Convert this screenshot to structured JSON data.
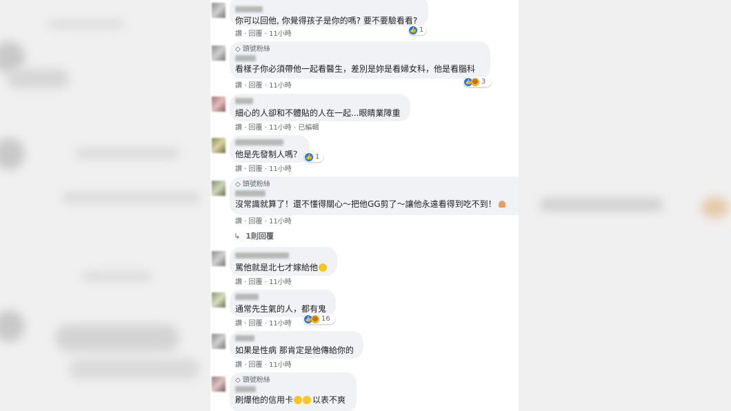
{
  "comments": [
    {
      "text": "你可以回他, 你覺得孩子是你的嗎? 要不要驗看看?",
      "meta": "讚 · 回覆 · 11小時",
      "reaction_count": "1",
      "top_fan": false
    },
    {
      "badge": "頭號粉絲",
      "text": "看樣子你必須帶他一起看醫生，差別是妳是看婦女科，他是看腦科",
      "meta": "讚 · 回覆 · 11小時",
      "reaction_count": "3",
      "top_fan": true
    },
    {
      "text": "細心的人卻和不體貼的人在一起...眼睛業障重",
      "meta": "讚 · 回覆 · 11小時 · 已編輯",
      "top_fan": false
    },
    {
      "text": "他是先發制人嗎？",
      "meta": "讚 · 回覆 · 11小時",
      "reaction_count": "1",
      "top_fan": false
    },
    {
      "badge": "頭號粉絲",
      "text": "沒常識就算了！還不懂得關心～把他GG剪了～讓他永遠看得到吃不到！",
      "meta": "讚 · 回覆 · 11小時",
      "replies": "1則回覆",
      "top_fan": true
    },
    {
      "text": "罵他就是北七才嫁給他",
      "meta": "讚 · 回覆 · 11小時",
      "top_fan": false
    },
    {
      "text": "通常先生氣的人，都有鬼",
      "meta": "讚 · 回覆 · 11小時",
      "reaction_count": "16",
      "top_fan": false
    },
    {
      "text": "如果是性病 那肯定是他傳給你的",
      "meta": "讚 · 回覆 · 11小時",
      "top_fan": false
    },
    {
      "badge": "頭號粉絲",
      "text": "刷爆他的信用卡",
      "text_suffix": "以表不爽",
      "top_fan": true
    }
  ]
}
